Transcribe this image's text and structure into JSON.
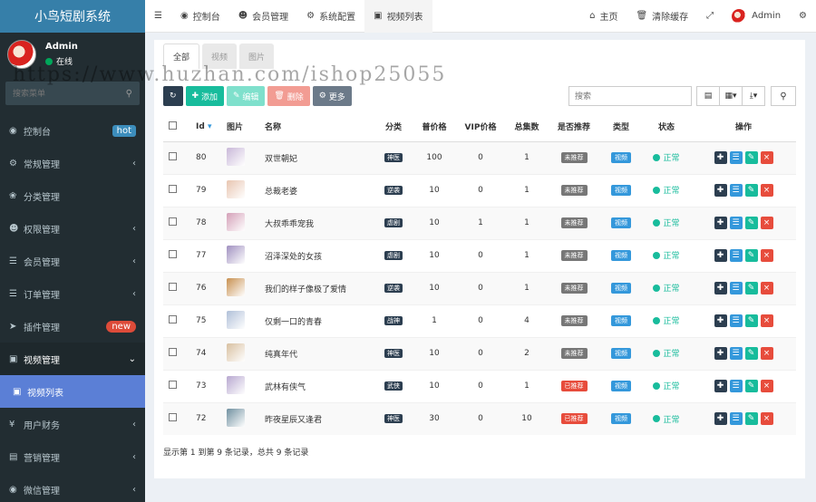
{
  "app": {
    "title": "小鸟短剧系统"
  },
  "user": {
    "name": "Admin",
    "status": "在线"
  },
  "sidebar": {
    "search_placeholder": "搜索菜单",
    "items": [
      {
        "label": "控制台",
        "badge": "hot"
      },
      {
        "label": "常规管理"
      },
      {
        "label": "分类管理"
      },
      {
        "label": "权限管理"
      },
      {
        "label": "会员管理"
      },
      {
        "label": "订单管理"
      },
      {
        "label": "插件管理",
        "badge": "new"
      },
      {
        "label": "视频管理"
      },
      {
        "label": "视频列表"
      },
      {
        "label": "用户财务"
      },
      {
        "label": "营销管理"
      },
      {
        "label": "微信管理"
      }
    ]
  },
  "topnav": {
    "tabs": [
      "控制台",
      "会员管理",
      "系统配置",
      "视频列表"
    ],
    "home": "主页",
    "clear_cache": "清除缓存",
    "user": "Admin"
  },
  "panel": {
    "tabs": [
      "全部",
      "视频",
      "图片"
    ],
    "toolbar": {
      "add": "添加",
      "edit": "编辑",
      "delete": "删除",
      "more": "更多",
      "search_placeholder": "搜索"
    },
    "columns": [
      "Id",
      "图片",
      "名称",
      "分类",
      "普价格",
      "VIP价格",
      "总集数",
      "是否推荐",
      "类型",
      "状态",
      "操作"
    ],
    "rows": [
      {
        "id": "80",
        "name": "双世朝妃",
        "cat": "神医",
        "price": "100",
        "vip": "0",
        "eps": "1",
        "rec": "未推荐",
        "type": "视频",
        "status": "正常"
      },
      {
        "id": "79",
        "name": "总裁老婆",
        "cat": "逆袭",
        "price": "10",
        "vip": "0",
        "eps": "1",
        "rec": "未推荐",
        "type": "视频",
        "status": "正常"
      },
      {
        "id": "78",
        "name": "大叔乖乖宠我",
        "cat": "虐剧",
        "price": "10",
        "vip": "1",
        "eps": "1",
        "rec": "未推荐",
        "type": "视频",
        "status": "正常"
      },
      {
        "id": "77",
        "name": "沼泽深处的女孩",
        "cat": "虐剧",
        "price": "10",
        "vip": "0",
        "eps": "1",
        "rec": "未推荐",
        "type": "视频",
        "status": "正常"
      },
      {
        "id": "76",
        "name": "我们的样子像极了爱情",
        "cat": "逆袭",
        "price": "10",
        "vip": "0",
        "eps": "1",
        "rec": "未推荐",
        "type": "视频",
        "status": "正常"
      },
      {
        "id": "75",
        "name": "仅剩一口的青春",
        "cat": "战神",
        "price": "1",
        "vip": "0",
        "eps": "4",
        "rec": "未推荐",
        "type": "视频",
        "status": "正常"
      },
      {
        "id": "74",
        "name": "纯真年代",
        "cat": "神医",
        "price": "10",
        "vip": "0",
        "eps": "2",
        "rec": "未推荐",
        "type": "视频",
        "status": "正常"
      },
      {
        "id": "73",
        "name": "武林有侠气",
        "cat": "武侠",
        "price": "10",
        "vip": "0",
        "eps": "1",
        "rec": "已推荐",
        "type": "视频",
        "status": "正常"
      },
      {
        "id": "72",
        "name": "昨夜星辰又逢君",
        "cat": "神医",
        "price": "30",
        "vip": "0",
        "eps": "10",
        "rec": "已推荐",
        "type": "视频",
        "status": "正常"
      }
    ],
    "footer": "显示第 1 到第 9 条记录，总共 9 条记录"
  },
  "watermark": "https://www.huzhan.com/ishop25055",
  "colors": {
    "sidebar": "#222d32",
    "brand": "#367fa9",
    "active": "#5b7fd6",
    "success": "#18bc9c",
    "danger": "#e74c3c"
  }
}
